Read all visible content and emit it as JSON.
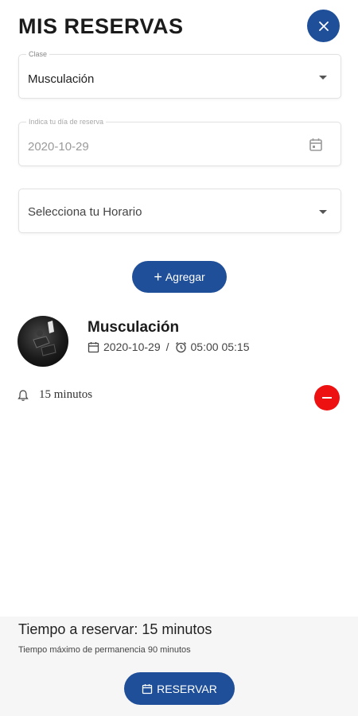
{
  "header": {
    "title": "MIS RESERVAS",
    "close_icon": "close-icon"
  },
  "form": {
    "clase": {
      "label": "Clase",
      "value": "Musculación"
    },
    "fecha": {
      "label": "Indica tu día de reserva",
      "value": "2020-10-29"
    },
    "horario": {
      "placeholder": "Selecciona tu Horario"
    },
    "add_button": {
      "label": "Agregar",
      "icon": "plus-icon"
    }
  },
  "booking": {
    "name": "Musculación",
    "date": "2020-10-29",
    "separator": "/",
    "time": "05:00 05:15",
    "reminder": "15 minutos"
  },
  "footer": {
    "title": "Tiempo a reservar: 15 minutos",
    "subtitle": "Tiempo máximo de permanencia 90 minutos",
    "reserve_button": {
      "label": "RESERVAR",
      "icon": "calendar-icon"
    }
  },
  "colors": {
    "primary": "#1f4f99",
    "danger": "#ee1111",
    "footer_bg": "#f6f6f6"
  }
}
